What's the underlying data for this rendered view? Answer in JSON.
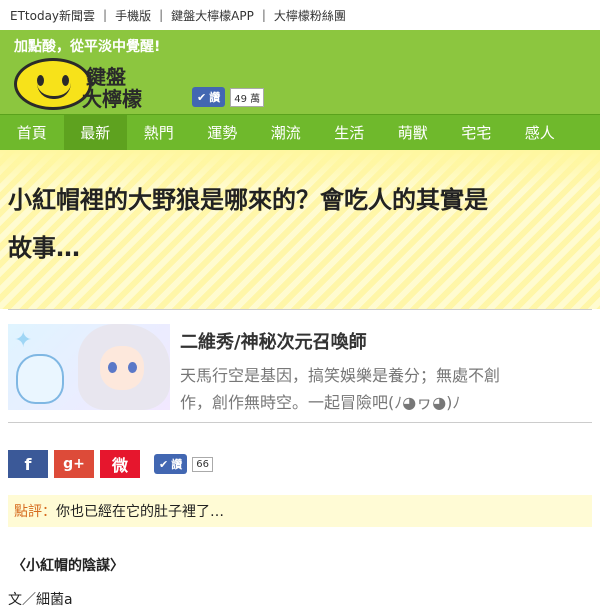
{
  "toplinks": [
    "ETtoday新聞雲",
    "手機版",
    "鍵盤大檸檬APP",
    "大檸檬粉絲團"
  ],
  "toplinks_sep": "|",
  "header": {
    "slogan": "加點酸，從平淡中覺醒!",
    "logo_line1": "鍵盤",
    "logo_line2": "大檸檬",
    "like_label": "讚",
    "like_count": "49 萬"
  },
  "nav": [
    "首頁",
    "最新",
    "熱門",
    "運勢",
    "潮流",
    "生活",
    "萌獸",
    "宅宅",
    "感人"
  ],
  "article": {
    "title_line1": "小紅帽裡的大野狼是哪來的？會吃人的其實是",
    "title_line2": "故事…",
    "author_name": "二維秀/神秘次元召喚師",
    "author_desc_line1": "天馬行空是基因，搞笑娛樂是養分；無處不創",
    "author_desc_line2": "作，創作無時空。一起冒險吧(ﾉ◕ヮ◕)ﾉ",
    "social": {
      "fb": "f",
      "gplus": "g+",
      "weibo": "微",
      "like_label": "讚",
      "like_count": "66"
    },
    "comment_label": "點評：",
    "comment_text": "你也已經在它的肚子裡了…",
    "subhead": "〈小紅帽的陰謀〉",
    "byline": "文／細菌a"
  },
  "colors": {
    "header_green": "#8cc63f",
    "nav_green": "#6fb92c",
    "lemon": "#f7e21a"
  }
}
